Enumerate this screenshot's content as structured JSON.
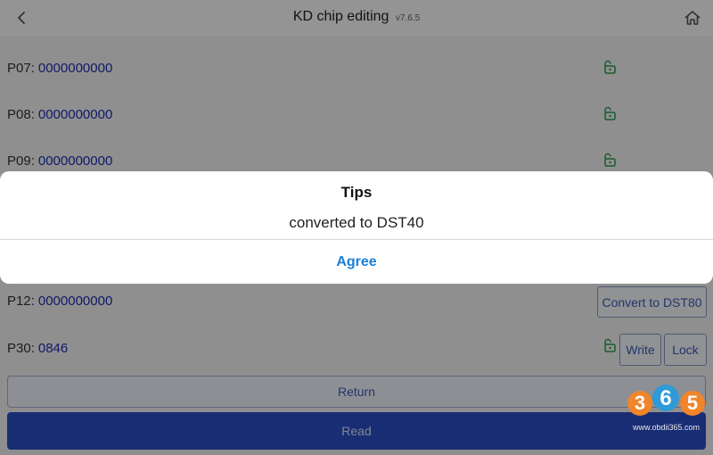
{
  "header": {
    "title": "KD chip editing",
    "version": "v7.6.5",
    "back_icon": "chevron-left-icon",
    "home_icon": "home-icon"
  },
  "rows": [
    {
      "label": "P07:",
      "value": "0000000000",
      "icon": "unlock-icon"
    },
    {
      "label": "P08:",
      "value": "0000000000",
      "icon": "unlock-icon"
    },
    {
      "label": "P09:",
      "value": "0000000000",
      "icon": "unlock-icon"
    },
    {
      "label": "P12:",
      "value": "0000000000",
      "button": "Convert to DST80"
    },
    {
      "label": "P30:",
      "value": "0846",
      "icon": "unlock-icon",
      "buttons": [
        "Write",
        "Lock"
      ]
    }
  ],
  "actions": {
    "return_label": "Return",
    "read_label": "Read"
  },
  "dialog": {
    "title": "Tips",
    "message": "converted to DST40",
    "agree_label": "Agree"
  },
  "watermark": {
    "digits": [
      "3",
      "6",
      "5"
    ],
    "url": "www.obdii365.com"
  },
  "colors": {
    "value_text": "#1c2db0",
    "accent_blue": "#2b4fc9",
    "link_blue": "#1a7fd6",
    "lock_green": "#2e9e4a",
    "watermark_orange": "#f0852a",
    "watermark_blue": "#2f9ad6"
  }
}
